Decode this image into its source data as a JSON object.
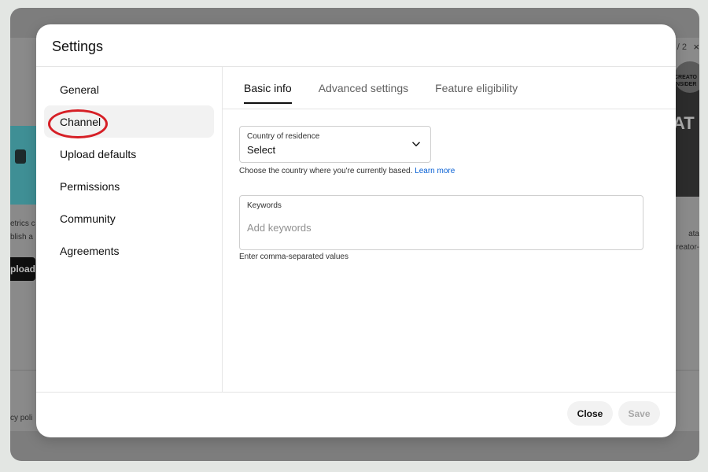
{
  "background": {
    "left_text_1": "etrics c",
    "left_text_2": "blish a",
    "left_upload": "pload",
    "left_footer": "cy poli",
    "pager": "/ 2",
    "pager_close": "×",
    "right_badge_text_1": "CREATO",
    "right_badge_text_2": "INSIDER",
    "right_big_text": "AT",
    "right_text_1": "ata",
    "right_text_2": "reator-"
  },
  "dialog": {
    "title": "Settings",
    "sidebar": {
      "items": [
        {
          "label": "General",
          "active": false
        },
        {
          "label": "Channel",
          "active": true
        },
        {
          "label": "Upload defaults",
          "active": false
        },
        {
          "label": "Permissions",
          "active": false
        },
        {
          "label": "Community",
          "active": false
        },
        {
          "label": "Agreements",
          "active": false
        }
      ]
    },
    "tabs": [
      {
        "label": "Basic info",
        "active": true
      },
      {
        "label": "Advanced settings",
        "active": false
      },
      {
        "label": "Feature eligibility",
        "active": false
      }
    ],
    "country": {
      "label": "Country of residence",
      "value": "Select",
      "help": "Choose the country where you're currently based.",
      "help_link": "Learn more"
    },
    "keywords": {
      "label": "Keywords",
      "placeholder": "Add keywords",
      "value": "",
      "help": "Enter comma-separated values"
    },
    "footer": {
      "close_label": "Close",
      "save_label": "Save",
      "save_disabled": true
    }
  },
  "colors": {
    "annotation_circle": "#d61f26",
    "link": "#065fd4",
    "active_item_bg": "#f2f2f2"
  }
}
